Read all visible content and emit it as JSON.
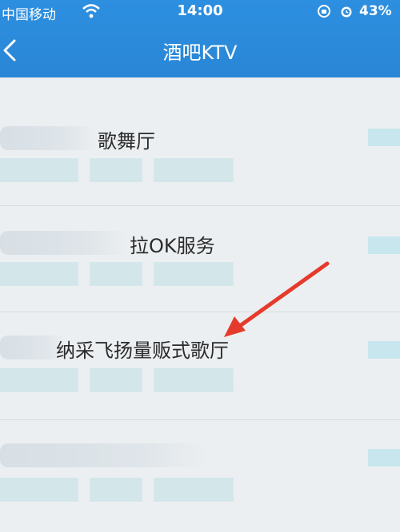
{
  "status_bar": {
    "carrier": "中国移动",
    "time": "14:00",
    "battery": "43%",
    "icons": [
      "wifi-icon",
      "orientation-lock-icon",
      "alarm-icon",
      "battery-icon"
    ]
  },
  "nav": {
    "back_icon": "chevron-left-icon",
    "title": "酒吧KTV"
  },
  "list": {
    "items": [
      {
        "name": "歌舞厅"
      },
      {
        "name": "拉OK服务"
      },
      {
        "name": "纳采飞扬量贩式歌厅"
      },
      {
        "name": ""
      }
    ]
  },
  "annotation": {
    "arrow_color": "#e53b2c"
  },
  "colors": {
    "nav_bg": "#2a86d6",
    "page_bg": "#eceff1"
  }
}
